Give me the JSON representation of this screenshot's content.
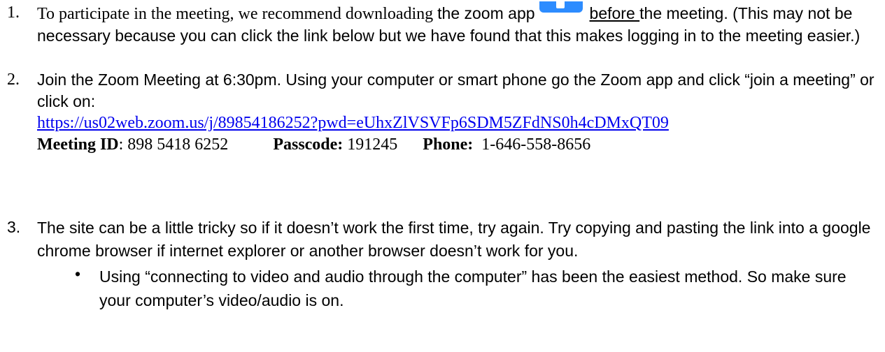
{
  "items": {
    "one": {
      "number": "1.",
      "before_icon": "To participate in the meeting, we recommend downloading ",
      "middle": "the zoom app",
      "icon_name": "zoom-app-icon",
      "underlined": "before ",
      "after_icon": "the meeting. (This may not be necessary because you can click the link below but we have found that this makes logging in to the meeting easier.)"
    },
    "two": {
      "number": "2.",
      "text": "Join the Zoom Meeting at 6:30pm. Using your computer or smart phone go the Zoom app and click “join a meeting” or click on:",
      "link": "https://us02web.zoom.us/j/89854186252?pwd=eUhxZlVSVFp6SDM5ZFdNS0h4cDMxQT09",
      "meeting_id_label": "Meeting ID",
      "meeting_id_value": ": 898 5418 6252",
      "passcode_label": "Passcode:",
      "passcode_value": " 191245",
      "phone_label": "Phone:",
      "phone_value": "  1-646-558-8656"
    },
    "three": {
      "number": "3.",
      "text": "The site can be a little tricky so if it doesn’t work the first time, try again. Try copying and pasting the link into a google chrome browser if internet explorer or another browser doesn’t work for you.",
      "bullet_symbol": "•",
      "bullet_text": "Using “connecting to video and audio through the computer” has been the easiest method. So make sure your computer’s video/audio is on."
    }
  },
  "colors": {
    "link": "#0000ee",
    "zoom_icon": "#2d8cff"
  }
}
